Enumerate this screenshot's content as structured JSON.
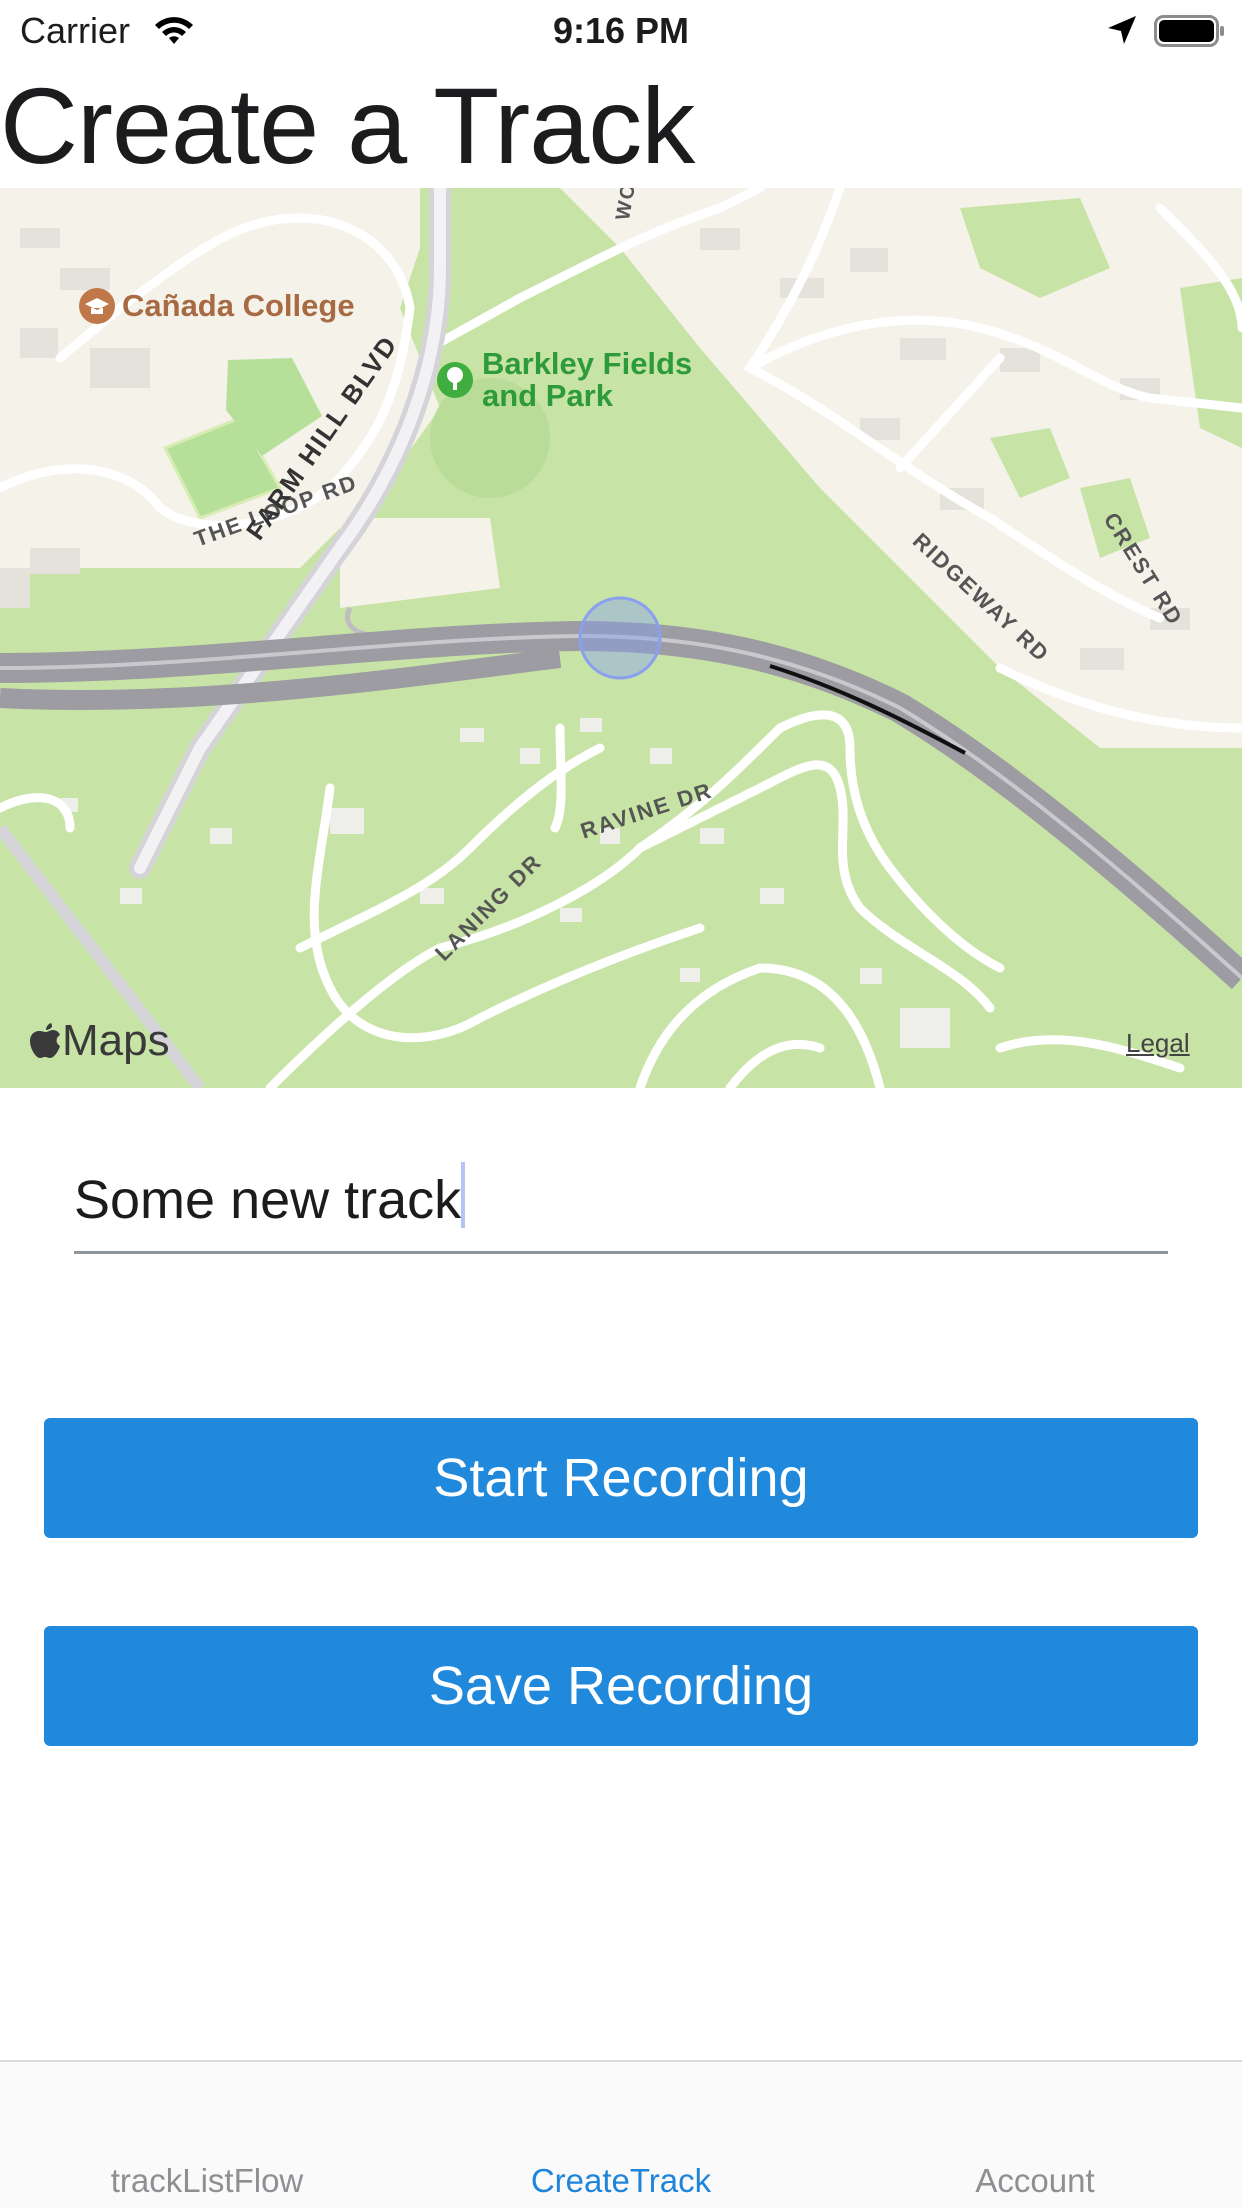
{
  "status_bar": {
    "carrier": "Carrier",
    "time": "9:16 PM",
    "icons": [
      "wifi-icon",
      "location-arrow-icon",
      "battery-icon"
    ]
  },
  "page": {
    "title": "Create a Track"
  },
  "map": {
    "labels": {
      "college": "Cañada College",
      "park_line1": "Barkley Fields",
      "park_line2": "and Park",
      "loop_rd": "THE LOOP RD",
      "farm_hill": "FARM HILL BLVD",
      "ridgeway": "RIDGEWAY RD",
      "crest": "CREST RD",
      "ravine": "RAVINE DR",
      "laning": "LANING DR",
      "top_road": "WOO"
    },
    "maps_logo": "Maps",
    "legal": "Legal",
    "colors": {
      "park": "#c8e3a6",
      "land": "#f5f2ea",
      "highway": "#a8a8ad",
      "user_location": "#8aa0ee"
    }
  },
  "form": {
    "track_name_value": "Some new track"
  },
  "buttons": {
    "start": "Start Recording",
    "save": "Save Recording",
    "color": "#2189dc"
  },
  "tabs": [
    {
      "label": "trackListFlow",
      "active": false
    },
    {
      "label": "CreateTrack",
      "active": true
    },
    {
      "label": "Account",
      "active": false
    }
  ]
}
